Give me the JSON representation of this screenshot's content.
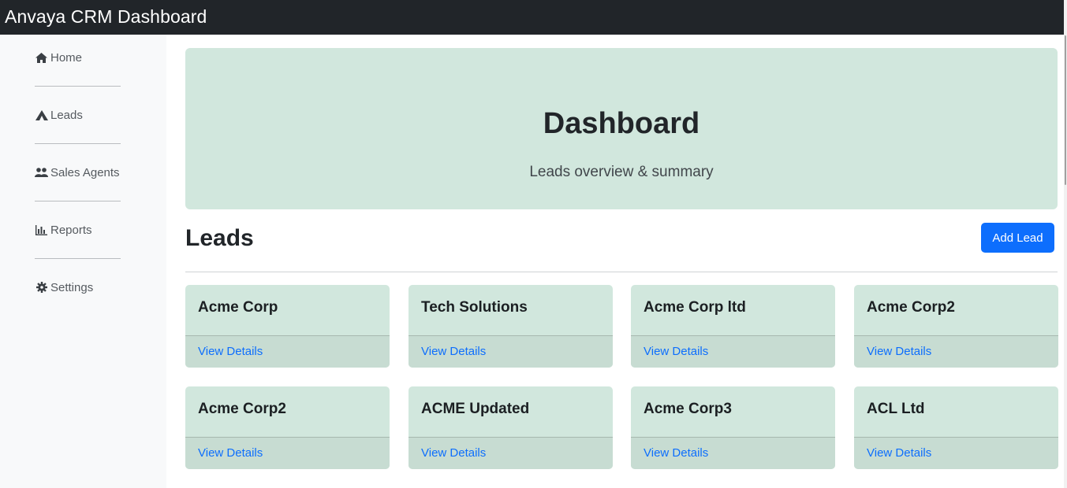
{
  "app": {
    "title": "Anvaya CRM Dashboard"
  },
  "sidebar": {
    "items": [
      {
        "label": "Home",
        "icon": "home-icon"
      },
      {
        "label": "Leads",
        "icon": "leads-icon"
      },
      {
        "label": "Sales Agents",
        "icon": "agents-icon"
      },
      {
        "label": "Reports",
        "icon": "reports-icon"
      },
      {
        "label": "Settings",
        "icon": "settings-icon"
      }
    ]
  },
  "hero": {
    "title": "Dashboard",
    "subtitle": "Leads overview & summary"
  },
  "leads": {
    "heading": "Leads",
    "add_label": "Add Lead",
    "link_label": "View Details",
    "cards": [
      {
        "name": "Acme Corp"
      },
      {
        "name": "Tech Solutions"
      },
      {
        "name": "Acme Corp ltd"
      },
      {
        "name": "Acme Corp2"
      },
      {
        "name": "Acme Corp2"
      },
      {
        "name": "ACME Updated"
      },
      {
        "name": "Acme Corp3"
      },
      {
        "name": "ACL Ltd"
      }
    ]
  },
  "colors": {
    "topbar": "#212529",
    "accent": "#0d6efd",
    "card": "#d1e7dd"
  }
}
